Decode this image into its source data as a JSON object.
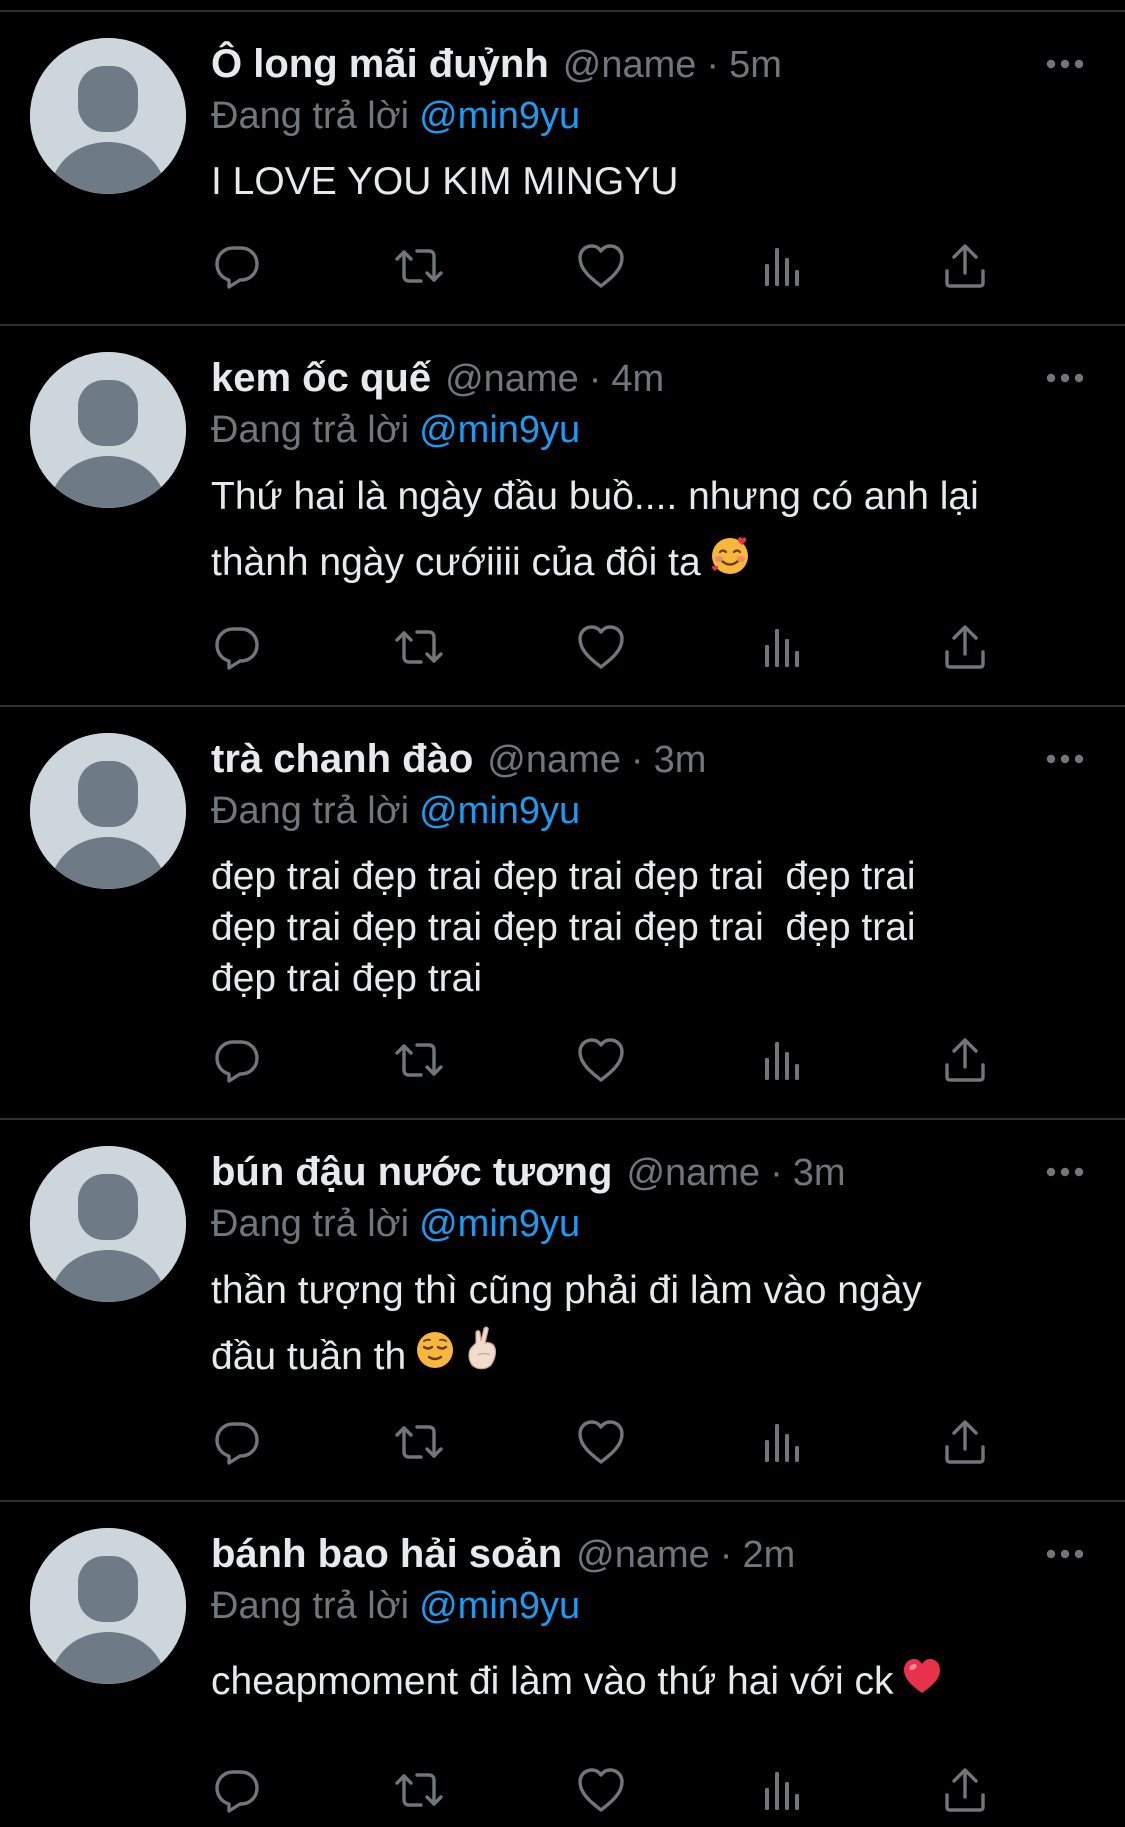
{
  "colors": {
    "background": "#000000",
    "text": "#e7e9ea",
    "muted": "#71767b",
    "link": "#1d9bf0",
    "divider": "#2f3336",
    "avatar_bg": "#cdd6dc",
    "avatar_fg": "#6e7b86"
  },
  "tweets": [
    {
      "name": "Ô long mãi đuỷnh",
      "handle": "@name",
      "separator": "·",
      "time": "5m",
      "reply_label": "Đang trả lời",
      "reply_to": "@min9yu",
      "text": "I LOVE YOU KIM MINGYU",
      "emoji": []
    },
    {
      "name": "kem ốc quế",
      "handle": "@name",
      "separator": "·",
      "time": "4m",
      "reply_label": "Đang trả lời",
      "reply_to": "@min9yu",
      "text": "Thứ hai là ngày đầu buồ.... nhưng có anh lại thành ngày cướiiii của đôi ta",
      "emoji": [
        "smiling-face-with-hearts-emoji"
      ]
    },
    {
      "name": "trà chanh đào",
      "handle": "@name",
      "separator": "·",
      "time": "3m",
      "reply_label": "Đang trả lời",
      "reply_to": "@min9yu",
      "text": "đẹp trai đẹp trai đẹp trai đẹp trai  đẹp trai\nđẹp trai đẹp trai đẹp trai đẹp trai  đẹp trai\nđẹp trai đẹp trai",
      "emoji": []
    },
    {
      "name": "bún đậu nước tương",
      "handle": "@name",
      "separator": "·",
      "time": "3m",
      "reply_label": "Đang trả lời",
      "reply_to": "@min9yu",
      "text": "thần tượng thì cũng phải đi làm vào ngày\nđầu tuần th",
      "emoji": [
        "relieved-face-emoji",
        "crossed-fingers-emoji"
      ]
    },
    {
      "name": "bánh bao hải soản",
      "handle": "@name",
      "separator": "·",
      "time": "2m",
      "reply_label": "Đang trả lời",
      "reply_to": "@min9yu",
      "text": "cheapmoment đi làm vào thứ hai với ck",
      "emoji": [
        "red-heart-emoji"
      ]
    }
  ],
  "action_icons": [
    "reply-icon",
    "retweet-icon",
    "like-icon",
    "views-icon",
    "share-icon"
  ],
  "more_icon": "more-options-icon"
}
